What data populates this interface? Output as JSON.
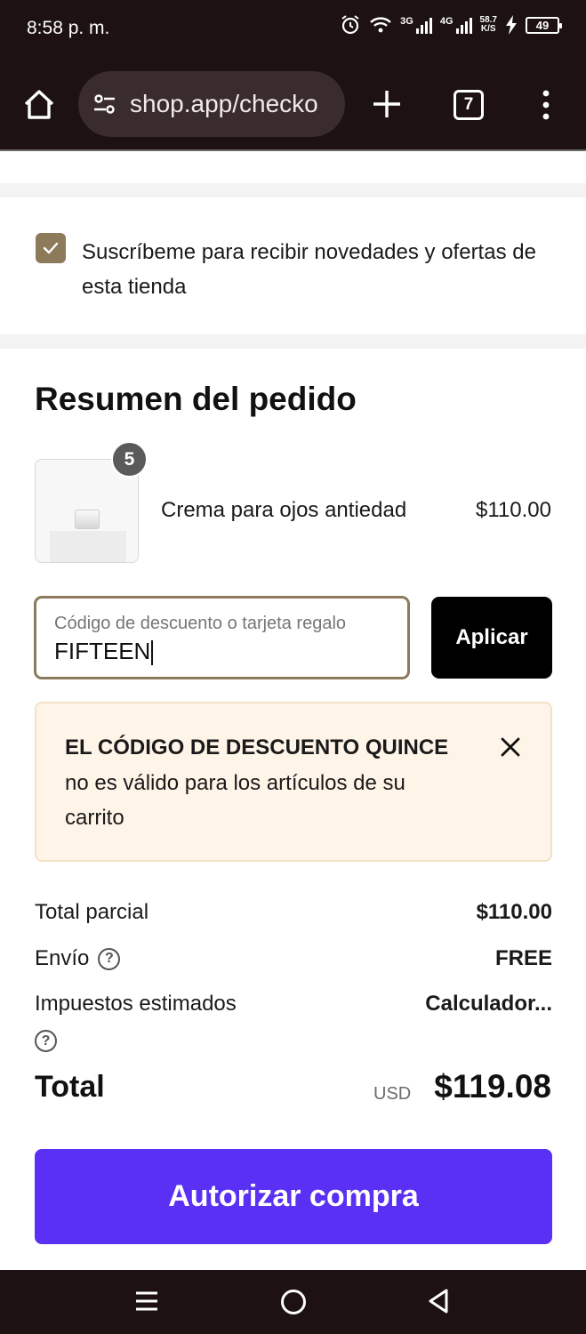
{
  "status_bar": {
    "time": "8:58 p. m.",
    "signal_1_label": "3G",
    "signal_2_label": "4G",
    "net_speed_value": "58.7",
    "net_speed_unit": "K/S",
    "battery": "49"
  },
  "browser": {
    "url": "shop.app/checko",
    "tab_count": "7"
  },
  "subscribe": {
    "checked": true,
    "label": "Suscríbeme para recibir novedades y ofertas de esta tienda"
  },
  "summary": {
    "title": "Resumen del pedido",
    "product": {
      "name": "Crema para ojos antiedad",
      "price": "$110.00",
      "quantity": "5"
    },
    "discount": {
      "placeholder": "Código de descuento o tarjeta regalo",
      "value": "FIFTEEN",
      "apply_label": "Aplicar"
    },
    "error": {
      "title": "EL CÓDIGO DE DESCUENTO QUINCE",
      "message": "no es válido para los artículos de su carrito"
    },
    "lines": {
      "subtotal_label": "Total parcial",
      "subtotal_value": "$110.00",
      "shipping_label": "Envío",
      "shipping_value": "FREE",
      "taxes_label": "Impuestos estimados",
      "taxes_value": "Calculador..."
    },
    "total": {
      "label": "Total",
      "currency": "USD",
      "value": "$119.08"
    },
    "pay_label": "Autorizar compra"
  },
  "colors": {
    "accent_purple": "#5a31f4",
    "checkbox_brown": "#8c7a5b",
    "error_bg": "#fff4e8",
    "chrome_dark": "#1d1111"
  }
}
